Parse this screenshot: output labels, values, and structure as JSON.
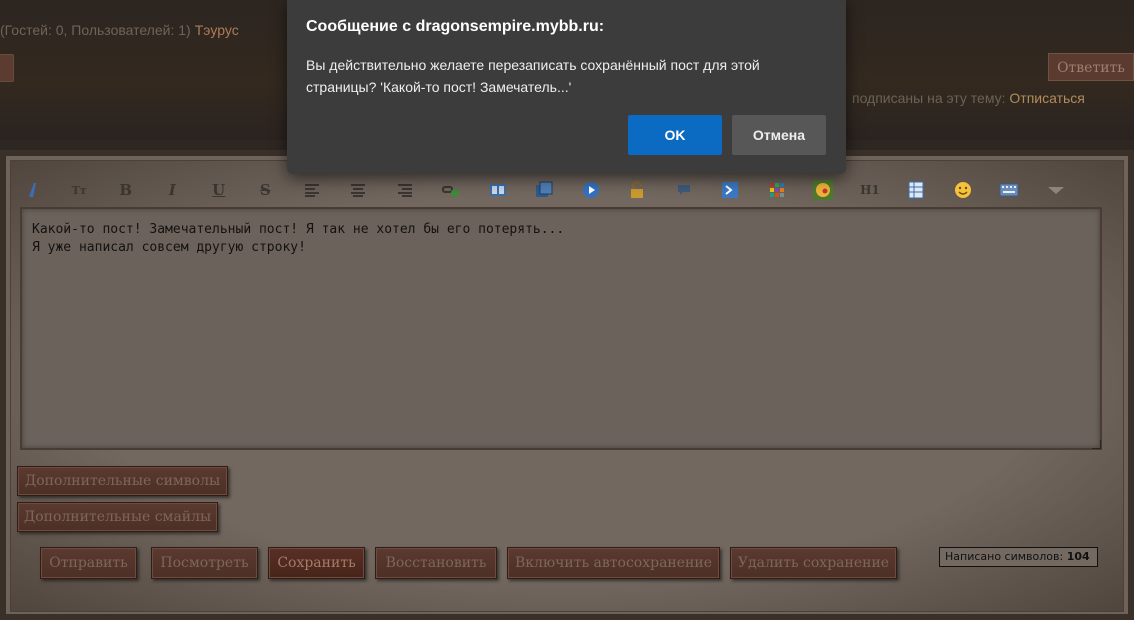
{
  "header": {
    "online_text": "(Гостей: 0, Пользователей: 1)",
    "online_user": "Тэурус",
    "reply_label": "Ответить",
    "subscribed_text": "подписаны на эту тему:",
    "unsubscribe_label": "Отписаться"
  },
  "toolbar": {
    "icons": [
      "font-color-icon",
      "font-size-icon",
      "bold-icon",
      "italic-icon",
      "underline-icon",
      "strikethrough-icon",
      "align-left-icon",
      "align-center-icon",
      "align-right-icon",
      "link-icon",
      "image-icon",
      "gallery-icon",
      "video-icon",
      "spoiler-lock-icon",
      "quote-icon",
      "code-icon",
      "color-palette-icon",
      "smile-icon",
      "heading-icon",
      "table-icon",
      "emoji-icon",
      "keyboard-icon",
      "more-icon"
    ],
    "font_size_label": "Tт",
    "bold_label": "B",
    "italic_label": "I",
    "underline_label": "U",
    "strike_label": "S",
    "heading_label": "H1"
  },
  "editor": {
    "text": "Какой-то пост! Замечательный пост! Я так не хотел бы его потерять...\nЯ уже написал совсем другую строку!"
  },
  "buttons": {
    "extra_symbols": "Дополнительные символы",
    "extra_smiles": "Дополнительные смайлы",
    "send": "Отправить",
    "preview": "Посмотреть",
    "save": "Сохранить",
    "restore": "Восстановить",
    "autosave": "Включить автосохранение",
    "delete_save": "Удалить сохранение"
  },
  "counter": {
    "label": "Написано символов:",
    "value": "104"
  },
  "dialog": {
    "title": "Сообщение с dragonsempire.mybb.ru:",
    "message": "Вы действительно желаете перезаписать сохранённый пост для этой страницы? 'Какой-то пост! Замечатель...'",
    "ok_label": "OK",
    "cancel_label": "Отмена"
  },
  "colors": {
    "accent_ok": "#0b6ac2",
    "dialog_bg": "#3c3c3c",
    "link_user": "#b07b55"
  }
}
